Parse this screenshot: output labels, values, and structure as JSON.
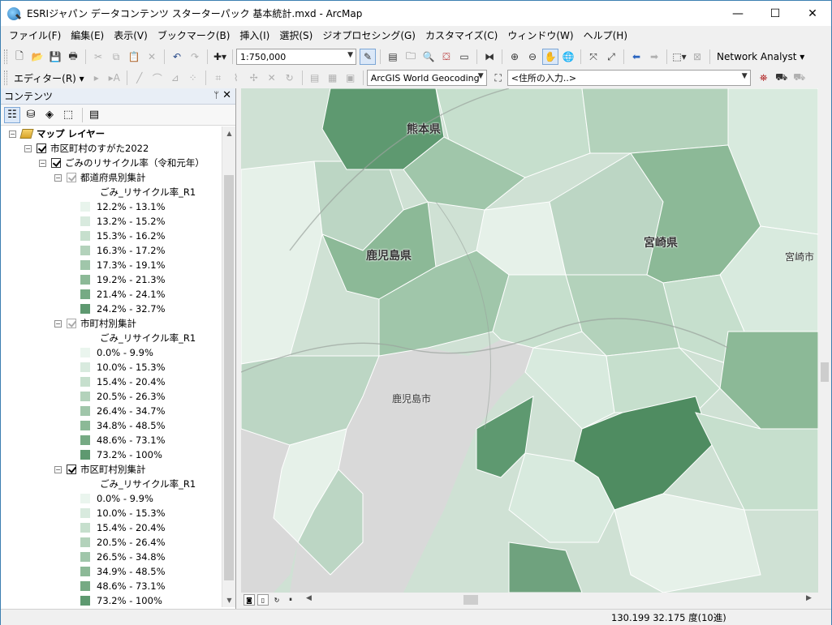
{
  "window": {
    "title": "ESRIジャパン データコンテンツ スターターパック 基本統計.mxd - ArcMap",
    "minimize": "—",
    "maximize": "☐",
    "close": "✕"
  },
  "menu": [
    "ファイル(F)",
    "編集(E)",
    "表示(V)",
    "ブックマーク(B)",
    "挿入(I)",
    "選択(S)",
    "ジオプロセシング(G)",
    "カスタマイズ(C)",
    "ウィンドウ(W)",
    "ヘルプ(H)"
  ],
  "toolbar": {
    "scale": "1:750,000",
    "network_analyst": "Network Analyst ▾",
    "editor": "エディター(R) ▾",
    "geocoder": "ArcGIS World Geocoding",
    "address_placeholder": "<住所の入力..>"
  },
  "toc": {
    "title": "コンテンツ",
    "pin": "ᛘ",
    "close": "✕",
    "root": "マップ レイヤー",
    "group1": "市区町村のすがた2022",
    "group2": "ごみのリサイクル率（令和元年）",
    "layers": [
      {
        "name": "都道府県別集計",
        "checked": false,
        "field": "ごみ_リサイクル率_R1",
        "classes": [
          {
            "label": "12.2% - 13.1%",
            "color": "#e8f4ec"
          },
          {
            "label": "13.2% - 15.2%",
            "color": "#d8eade"
          },
          {
            "label": "15.3% - 16.2%",
            "color": "#c6dfcd"
          },
          {
            "label": "16.3% - 17.2%",
            "color": "#b3d2bb"
          },
          {
            "label": "17.3% - 19.1%",
            "color": "#a0c6aa"
          },
          {
            "label": "19.2% - 21.3%",
            "color": "#8cb997"
          },
          {
            "label": "21.4% - 24.1%",
            "color": "#76aa84"
          },
          {
            "label": "24.2% - 32.7%",
            "color": "#5e9970"
          }
        ]
      },
      {
        "name": "市町村別集計",
        "checked": false,
        "field": "ごみ_リサイクル率_R1",
        "classes": [
          {
            "label": "0.0% - 9.9%",
            "color": "#eaf5ee"
          },
          {
            "label": "10.0% - 15.3%",
            "color": "#d8eade"
          },
          {
            "label": "15.4% - 20.4%",
            "color": "#c6dfcd"
          },
          {
            "label": "20.5% - 26.3%",
            "color": "#b3d2bb"
          },
          {
            "label": "26.4% - 34.7%",
            "color": "#a0c6aa"
          },
          {
            "label": "34.8% - 48.5%",
            "color": "#8cb997"
          },
          {
            "label": "48.6% - 73.1%",
            "color": "#76aa84"
          },
          {
            "label": "73.2% - 100%",
            "color": "#5e9970"
          }
        ]
      },
      {
        "name": "市区町村別集計",
        "checked": true,
        "field": "ごみ_リサイクル率_R1",
        "classes": [
          {
            "label": "0.0% - 9.9%",
            "color": "#eaf5ee"
          },
          {
            "label": "10.0% - 15.3%",
            "color": "#d8eade"
          },
          {
            "label": "15.4% - 20.4%",
            "color": "#c6dfcd"
          },
          {
            "label": "20.5% - 26.4%",
            "color": "#b3d2bb"
          },
          {
            "label": "26.5% - 34.8%",
            "color": "#a0c6aa"
          },
          {
            "label": "34.9% - 48.5%",
            "color": "#8cb997"
          },
          {
            "label": "48.6% - 73.1%",
            "color": "#76aa84"
          },
          {
            "label": "73.2% - 100%",
            "color": "#5e9970"
          }
        ]
      }
    ]
  },
  "map": {
    "labels": {
      "kumamoto": "熊本県",
      "kagoshima": "鹿児島県",
      "miyazaki": "宮崎県",
      "kagoshima_city": "鹿児島市",
      "miyazaki_city": "宮崎市"
    }
  },
  "status": {
    "coords": "130.199  32.175 度(10進)"
  }
}
